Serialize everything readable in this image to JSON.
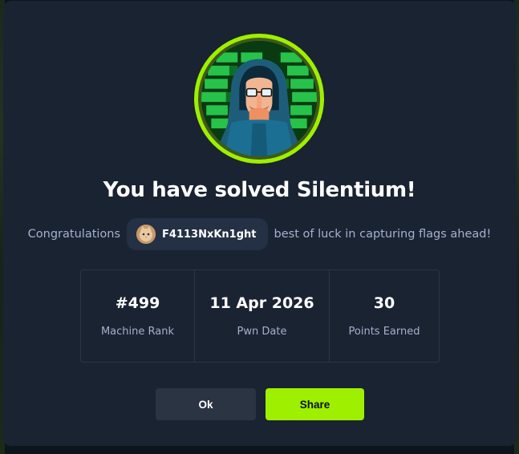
{
  "modal": {
    "title": "You have solved Silentium!",
    "congrats_prefix": "Congratulations",
    "username": "F4113NxKn1ght",
    "congrats_suffix": "best of luck in capturing flags ahead!"
  },
  "stats": [
    {
      "value": "#499",
      "label": "Machine Rank"
    },
    {
      "value": "11 Apr 2026",
      "label": "Pwn Date"
    },
    {
      "value": "30",
      "label": "Points Earned"
    }
  ],
  "buttons": {
    "ok_label": "Ok",
    "share_label": "Share"
  },
  "colors": {
    "accent": "#9fef00",
    "modal_bg": "#1a2332",
    "text_muted": "#a4b1cd"
  }
}
